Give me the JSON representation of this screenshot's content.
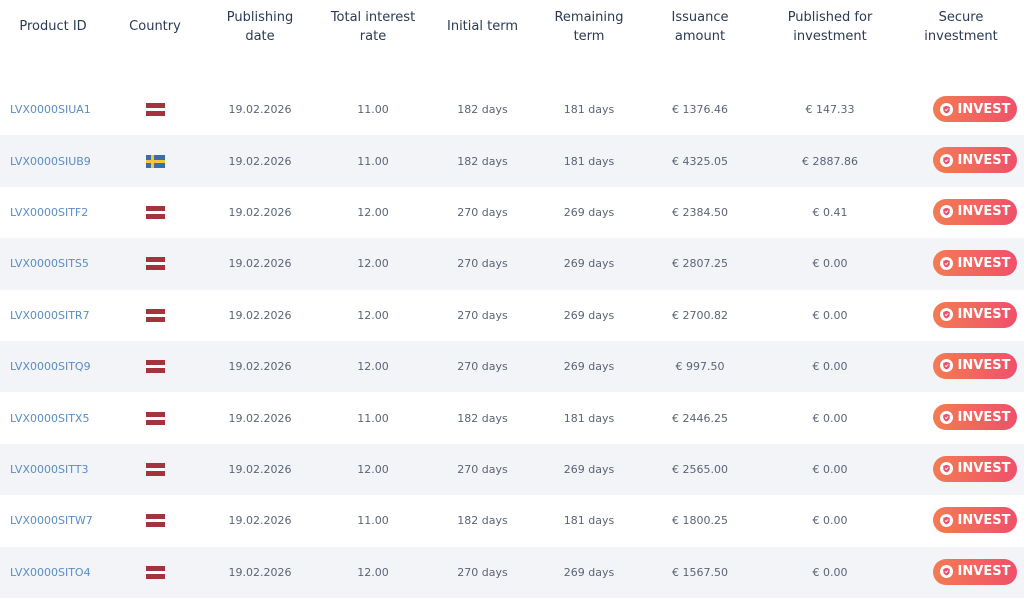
{
  "columns": {
    "product_id": "Product ID",
    "country": "Country",
    "publishing_date": [
      "Publishing",
      "date"
    ],
    "interest_rate": [
      "Total interest",
      "rate"
    ],
    "initial_term": "Initial term",
    "remaining_term": [
      "Remaining",
      "term"
    ],
    "issuance_amount": [
      "Issuance",
      "amount"
    ],
    "published_for_investment": [
      "Published for",
      "investment"
    ],
    "secure_investment": [
      "Secure",
      "investment"
    ]
  },
  "invest_label": "INVEST",
  "flag_icons": {
    "LV": "latvia-flag-icon",
    "SE": "sweden-flag-icon"
  },
  "colors": {
    "accent": "#f0506a",
    "accent_start": "#f27c53",
    "link": "#5a8dc6",
    "row_alt": "#f3f4f8"
  },
  "rows": [
    {
      "product_id": "LVX0000SIUA1",
      "country": "LV",
      "publishing_date": "19.02.2026",
      "interest_rate": "11.00",
      "initial_term": "182 days",
      "remaining_term": "181 days",
      "issuance_amount": "€ 1376.46",
      "published_for_investment": "€ 147.33"
    },
    {
      "product_id": "LVX0000SIUB9",
      "country": "SE",
      "publishing_date": "19.02.2026",
      "interest_rate": "11.00",
      "initial_term": "182 days",
      "remaining_term": "181 days",
      "issuance_amount": "€ 4325.05",
      "published_for_investment": "€ 2887.86"
    },
    {
      "product_id": "LVX0000SITF2",
      "country": "LV",
      "publishing_date": "19.02.2026",
      "interest_rate": "12.00",
      "initial_term": "270 days",
      "remaining_term": "269 days",
      "issuance_amount": "€ 2384.50",
      "published_for_investment": "€ 0.41"
    },
    {
      "product_id": "LVX0000SITS5",
      "country": "LV",
      "publishing_date": "19.02.2026",
      "interest_rate": "12.00",
      "initial_term": "270 days",
      "remaining_term": "269 days",
      "issuance_amount": "€ 2807.25",
      "published_for_investment": "€ 0.00"
    },
    {
      "product_id": "LVX0000SITR7",
      "country": "LV",
      "publishing_date": "19.02.2026",
      "interest_rate": "12.00",
      "initial_term": "270 days",
      "remaining_term": "269 days",
      "issuance_amount": "€ 2700.82",
      "published_for_investment": "€ 0.00"
    },
    {
      "product_id": "LVX0000SITQ9",
      "country": "LV",
      "publishing_date": "19.02.2026",
      "interest_rate": "12.00",
      "initial_term": "270 days",
      "remaining_term": "269 days",
      "issuance_amount": "€ 997.50",
      "published_for_investment": "€ 0.00"
    },
    {
      "product_id": "LVX0000SITX5",
      "country": "LV",
      "publishing_date": "19.02.2026",
      "interest_rate": "11.00",
      "initial_term": "182 days",
      "remaining_term": "181 days",
      "issuance_amount": "€ 2446.25",
      "published_for_investment": "€ 0.00"
    },
    {
      "product_id": "LVX0000SITT3",
      "country": "LV",
      "publishing_date": "19.02.2026",
      "interest_rate": "12.00",
      "initial_term": "270 days",
      "remaining_term": "269 days",
      "issuance_amount": "€ 2565.00",
      "published_for_investment": "€ 0.00"
    },
    {
      "product_id": "LVX0000SITW7",
      "country": "LV",
      "publishing_date": "19.02.2026",
      "interest_rate": "11.00",
      "initial_term": "182 days",
      "remaining_term": "181 days",
      "issuance_amount": "€ 1800.25",
      "published_for_investment": "€ 0.00"
    },
    {
      "product_id": "LVX0000SITO4",
      "country": "LV",
      "publishing_date": "19.02.2026",
      "interest_rate": "12.00",
      "initial_term": "270 days",
      "remaining_term": "269 days",
      "issuance_amount": "€ 1567.50",
      "published_for_investment": "€ 0.00"
    }
  ]
}
